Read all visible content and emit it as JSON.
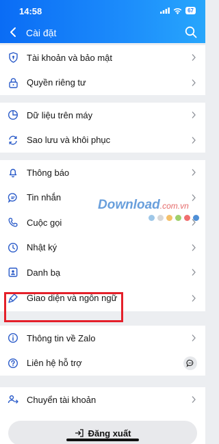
{
  "status_bar": {
    "time": "14:58",
    "battery": "67"
  },
  "nav": {
    "title": "Cài đặt"
  },
  "groups": [
    {
      "items": [
        {
          "label": "Tài khoản và bảo mật",
          "icon": "shield-icon"
        },
        {
          "label": "Quyền riêng tư",
          "icon": "lock-icon"
        }
      ]
    },
    {
      "items": [
        {
          "label": "Dữ liệu trên máy",
          "icon": "pie-chart-icon"
        },
        {
          "label": "Sao lưu và khôi phục",
          "icon": "sync-icon"
        }
      ]
    },
    {
      "items": [
        {
          "label": "Thông báo",
          "icon": "bell-icon"
        },
        {
          "label": "Tin nhắn",
          "icon": "message-icon"
        },
        {
          "label": "Cuộc gọi",
          "icon": "phone-icon"
        },
        {
          "label": "Nhật ký",
          "icon": "clock-icon"
        },
        {
          "label": "Danh bạ",
          "icon": "contacts-icon"
        },
        {
          "label": "Giao diện và ngôn ngữ",
          "icon": "brush-icon"
        }
      ]
    },
    {
      "items": [
        {
          "label": "Thông tin về Zalo",
          "icon": "info-icon"
        },
        {
          "label": "Liên hệ hỗ trợ",
          "icon": "help-icon"
        }
      ]
    },
    {
      "items": [
        {
          "label": "Chuyển tài khoản",
          "icon": "switch-account-icon"
        }
      ]
    }
  ],
  "logout": {
    "label": "Đăng xuất"
  },
  "watermark": {
    "brand": "Download",
    "domain": ".com.vn"
  },
  "colors": {
    "accent": "#1a7ff8",
    "highlight": "#e4202a"
  }
}
